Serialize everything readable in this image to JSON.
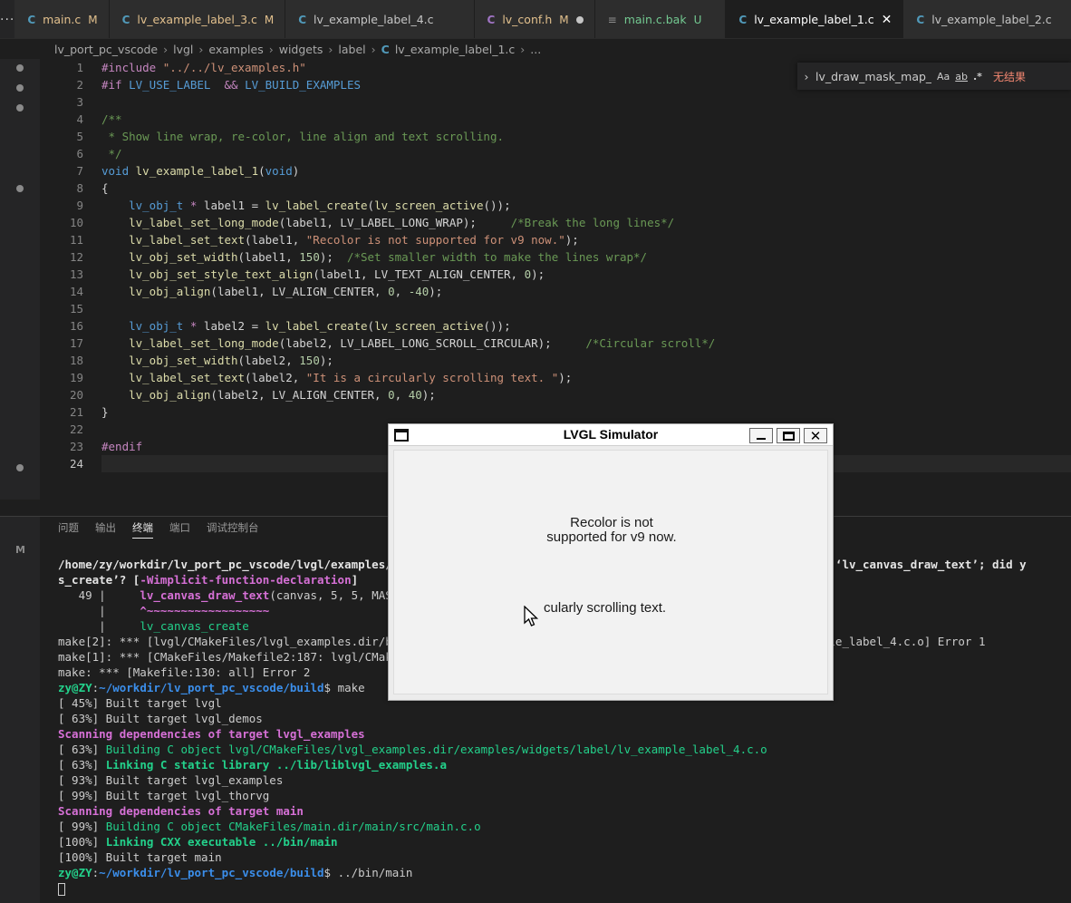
{
  "tabs": [
    {
      "label": "main.c",
      "badge": "M",
      "kind": "c",
      "state": "m"
    },
    {
      "label": "lv_example_label_3.c",
      "badge": "M",
      "kind": "c",
      "state": "m"
    },
    {
      "label": "lv_example_label_4.c",
      "badge": "",
      "kind": "c",
      "state": "n"
    },
    {
      "label": "lv_conf.h",
      "badge": "M",
      "kind": "h",
      "state": "m"
    },
    {
      "label": "main.c.bak",
      "badge": "U",
      "kind": "bak",
      "state": "u"
    },
    {
      "label": "lv_example_label_1.c",
      "badge": "",
      "kind": "c",
      "state": "a"
    },
    {
      "label": "lv_example_label_2.c",
      "badge": "",
      "kind": "c",
      "state": "n"
    }
  ],
  "icons": {
    "c_file": "C",
    "h_file": "C",
    "bak_file": "≡",
    "json_file": "{}",
    "more": "···",
    "close": "✕"
  },
  "breadcrumb": [
    "lv_port_pc_vscode",
    "lvgl",
    "examples",
    "widgets",
    "label",
    "lv_example_label_1.c",
    "..."
  ],
  "editor": {
    "line_numbers": [
      "1",
      "2",
      "3",
      "4",
      "5",
      "6",
      "7",
      "8",
      "9",
      "10",
      "11",
      "12",
      "13",
      "14",
      "15",
      "16",
      "17",
      "18",
      "19",
      "20",
      "21",
      "22",
      "23",
      "24"
    ],
    "current_line": 24
  },
  "find": {
    "value": "lv_draw_mask_map_pa",
    "case_label": "Aa",
    "word_label": "ab",
    "regex_label": ".*",
    "result": "无结果"
  },
  "panel": {
    "tabs": [
      "问题",
      "输出",
      "终端",
      "端口",
      "调试控制台"
    ],
    "active_tab": "终端",
    "badge": "M"
  },
  "simulator": {
    "title": "LVGL Simulator",
    "label1": "Recolor is not supported for v9 now.",
    "label2": "cularly scrolling text."
  },
  "colors": {
    "keyword": "#c586c0",
    "type": "#569cd6",
    "function": "#dcdcaa",
    "string": "#ce9178",
    "number": "#b5cea8",
    "comment": "#6a9955"
  }
}
